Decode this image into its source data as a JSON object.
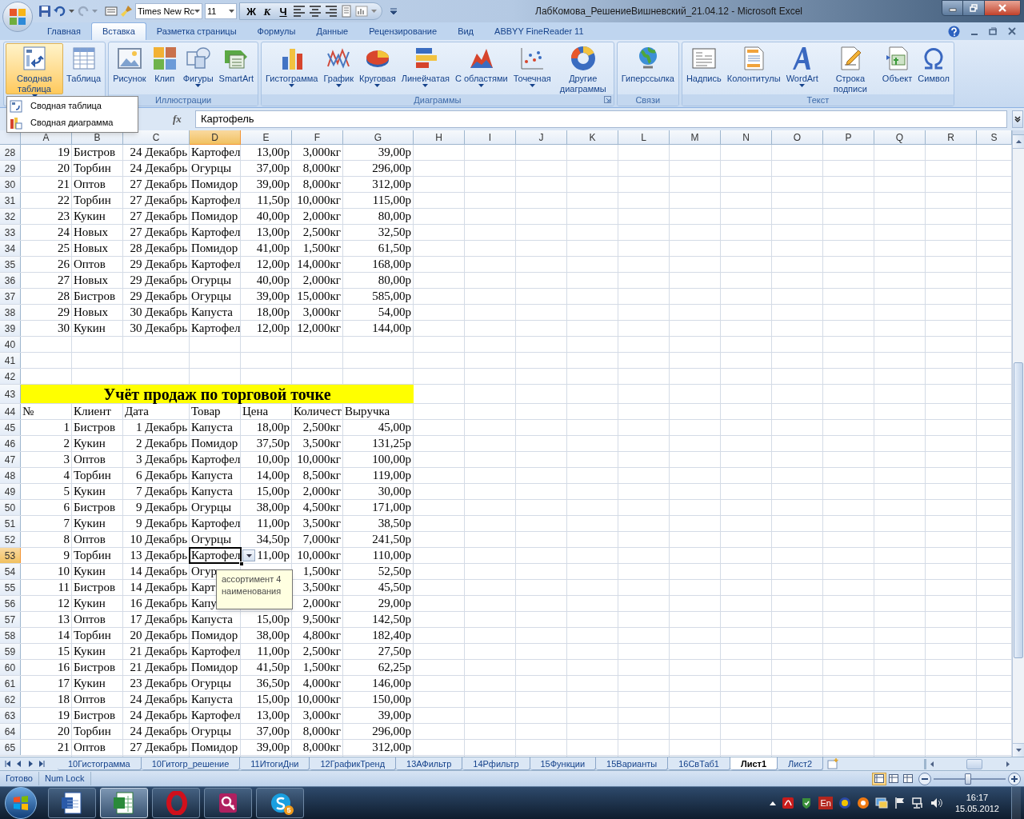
{
  "window": {
    "title": "ЛабКомова_РешениеВишневский_21.04.12 - Microsoft Excel"
  },
  "quick_access": {
    "font_box": "Times New Rc",
    "size_box": "11",
    "format_buttons": [
      "Ж",
      "К",
      "Ч"
    ]
  },
  "ribbon_tabs": [
    {
      "label": "Главная",
      "selected": false
    },
    {
      "label": "Вставка",
      "selected": true
    },
    {
      "label": "Разметка страницы",
      "selected": false
    },
    {
      "label": "Формулы",
      "selected": false
    },
    {
      "label": "Данные",
      "selected": false
    },
    {
      "label": "Рецензирование",
      "selected": false
    },
    {
      "label": "Вид",
      "selected": false
    },
    {
      "label": "ABBYY FineReader 11",
      "selected": false
    }
  ],
  "ribbon_groups": [
    {
      "buttons": [
        {
          "label": "Сводная таблица",
          "dropdown": true,
          "selected": true
        },
        {
          "label": "Таблица",
          "dropdown": false,
          "selected": false
        }
      ]
    },
    {
      "label": "Иллюстрации",
      "buttons": [
        {
          "label": "Рисунок",
          "dropdown": false,
          "selected": false
        },
        {
          "label": "Клип",
          "dropdown": false,
          "selected": false
        },
        {
          "label": "Фигуры",
          "dropdown": true,
          "selected": false
        },
        {
          "label": "SmartArt",
          "dropdown": false,
          "selected": false
        }
      ]
    },
    {
      "label": "Диаграммы",
      "launcher": true,
      "buttons": [
        {
          "label": "Гистограмма",
          "dropdown": true,
          "selected": false
        },
        {
          "label": "График",
          "dropdown": true,
          "selected": false
        },
        {
          "label": "Круговая",
          "dropdown": true,
          "selected": false
        },
        {
          "label": "Линейчатая",
          "dropdown": true,
          "selected": false
        },
        {
          "label": "С областями",
          "dropdown": true,
          "selected": false
        },
        {
          "label": "Точечная",
          "dropdown": true,
          "selected": false
        },
        {
          "label": "Другие диаграммы",
          "dropdown": true,
          "selected": false
        }
      ]
    },
    {
      "label": "Связи",
      "buttons": [
        {
          "label": "Гиперссылка",
          "dropdown": false,
          "selected": false
        }
      ]
    },
    {
      "label": "Текст",
      "buttons": [
        {
          "label": "Надпись",
          "dropdown": false,
          "selected": false
        },
        {
          "label": "Колонтитулы",
          "dropdown": false,
          "selected": false
        },
        {
          "label": "WordArt",
          "dropdown": true,
          "selected": false
        },
        {
          "label": "Строка подписи",
          "dropdown": true,
          "selected": false
        },
        {
          "label": "Объект",
          "dropdown": false,
          "selected": false
        },
        {
          "label": "Символ",
          "dropdown": false,
          "selected": false
        }
      ]
    }
  ],
  "dropdown_menu": {
    "items": [
      "Сводная таблица",
      "Сводная диаграмма"
    ]
  },
  "formula_bar": {
    "fx_label": "fx",
    "value": "Картофель"
  },
  "grid": {
    "cell_dropdown": true,
    "columns": [
      {
        "label": "A",
        "selected": false
      },
      {
        "label": "B",
        "selected": false
      },
      {
        "label": "C",
        "selected": false
      },
      {
        "label": "D",
        "selected": true
      },
      {
        "label": "E",
        "selected": false
      },
      {
        "label": "F",
        "selected": false
      },
      {
        "label": "G",
        "selected": false
      },
      {
        "label": "H",
        "selected": false
      },
      {
        "label": "I",
        "selected": false
      },
      {
        "label": "J",
        "selected": false
      },
      {
        "label": "K",
        "selected": false
      },
      {
        "label": "L",
        "selected": false
      },
      {
        "label": "M",
        "selected": false
      },
      {
        "label": "N",
        "selected": false
      },
      {
        "label": "O",
        "selected": false
      },
      {
        "label": "P",
        "selected": false
      },
      {
        "label": "Q",
        "selected": false
      },
      {
        "label": "R",
        "selected": false
      },
      {
        "label": "S",
        "selected": false
      }
    ],
    "rows": [
      {
        "header": "28",
        "selected": false,
        "kind": "data",
        "cells": [
          "19",
          "Бистров",
          "24 Декабрь",
          "Картофел",
          "13,00р",
          "3,000кг",
          "39,00р"
        ]
      },
      {
        "header": "29",
        "selected": false,
        "kind": "data",
        "cells": [
          "20",
          "Торбин",
          "24 Декабрь",
          "Огурцы",
          "37,00р",
          "8,000кг",
          "296,00р"
        ]
      },
      {
        "header": "30",
        "selected": false,
        "kind": "data",
        "cells": [
          "21",
          "Оптов",
          "27 Декабрь",
          "Помидор",
          "39,00р",
          "8,000кг",
          "312,00р"
        ]
      },
      {
        "header": "31",
        "selected": false,
        "kind": "data",
        "cells": [
          "22",
          "Торбин",
          "27 Декабрь",
          "Картофел",
          "11,50р",
          "10,000кг",
          "115,00р"
        ]
      },
      {
        "header": "32",
        "selected": false,
        "kind": "data",
        "cells": [
          "23",
          "Кукин",
          "27 Декабрь",
          "Помидор",
          "40,00р",
          "2,000кг",
          "80,00р"
        ]
      },
      {
        "header": "33",
        "selected": false,
        "kind": "data",
        "cells": [
          "24",
          "Новых",
          "27 Декабрь",
          "Картофел",
          "13,00р",
          "2,500кг",
          "32,50р"
        ]
      },
      {
        "header": "34",
        "selected": false,
        "kind": "data",
        "cells": [
          "25",
          "Новых",
          "28 Декабрь",
          "Помидор",
          "41,00р",
          "1,500кг",
          "61,50р"
        ]
      },
      {
        "header": "35",
        "selected": false,
        "kind": "data",
        "cells": [
          "26",
          "Оптов",
          "29 Декабрь",
          "Картофел",
          "12,00р",
          "14,000кг",
          "168,00р"
        ]
      },
      {
        "header": "36",
        "selected": false,
        "kind": "data",
        "cells": [
          "27",
          "Новых",
          "29 Декабрь",
          "Огурцы",
          "40,00р",
          "2,000кг",
          "80,00р"
        ]
      },
      {
        "header": "37",
        "selected": false,
        "kind": "data",
        "cells": [
          "28",
          "Бистров",
          "29 Декабрь",
          "Огурцы",
          "39,00р",
          "15,000кг",
          "585,00р"
        ]
      },
      {
        "header": "38",
        "selected": false,
        "kind": "data",
        "cells": [
          "29",
          "Новых",
          "30 Декабрь",
          "Капуста",
          "18,00р",
          "3,000кг",
          "54,00р"
        ]
      },
      {
        "header": "39",
        "selected": false,
        "kind": "data",
        "cells": [
          "30",
          "Кукин",
          "30 Декабрь",
          "Картофел",
          "12,00р",
          "12,000кг",
          "144,00р"
        ]
      },
      {
        "header": "40",
        "selected": false,
        "kind": "empty"
      },
      {
        "header": "41",
        "selected": false,
        "kind": "empty"
      },
      {
        "header": "42",
        "selected": false,
        "kind": "empty"
      },
      {
        "header": "43",
        "selected": false,
        "kind": "title",
        "text": "Учёт продаж по торговой точке"
      },
      {
        "header": "44",
        "selected": false,
        "kind": "header",
        "cells": [
          "№",
          "Клиент",
          "Дата",
          "Товар",
          "Цена",
          "Количест",
          "Выручка"
        ]
      },
      {
        "header": "45",
        "selected": false,
        "kind": "data",
        "cells": [
          "1",
          "Бистров",
          "1 Декабрь",
          "Капуста",
          "18,00р",
          "2,500кг",
          "45,00р"
        ]
      },
      {
        "header": "46",
        "selected": false,
        "kind": "data",
        "cells": [
          "2",
          "Кукин",
          "2 Декабрь",
          "Помидор",
          "37,50р",
          "3,500кг",
          "131,25р"
        ]
      },
      {
        "header": "47",
        "selected": false,
        "kind": "data",
        "cells": [
          "3",
          "Оптов",
          "3 Декабрь",
          "Картофел",
          "10,00р",
          "10,000кг",
          "100,00р"
        ]
      },
      {
        "header": "48",
        "selected": false,
        "kind": "data",
        "cells": [
          "4",
          "Торбин",
          "6 Декабрь",
          "Капуста",
          "14,00р",
          "8,500кг",
          "119,00р"
        ]
      },
      {
        "header": "49",
        "selected": false,
        "kind": "data",
        "cells": [
          "5",
          "Кукин",
          "7 Декабрь",
          "Капуста",
          "15,00р",
          "2,000кг",
          "30,00р"
        ]
      },
      {
        "header": "50",
        "selected": false,
        "kind": "data",
        "cells": [
          "6",
          "Бистров",
          "9 Декабрь",
          "Огурцы",
          "38,00р",
          "4,500кг",
          "171,00р"
        ]
      },
      {
        "header": "51",
        "selected": false,
        "kind": "data",
        "cells": [
          "7",
          "Кукин",
          "9 Декабрь",
          "Картофел",
          "11,00р",
          "3,500кг",
          "38,50р"
        ]
      },
      {
        "header": "52",
        "selected": false,
        "kind": "data",
        "cells": [
          "8",
          "Оптов",
          "10 Декабрь",
          "Огурцы",
          "34,50р",
          "7,000кг",
          "241,50р"
        ]
      },
      {
        "header": "53",
        "selected": true,
        "kind": "data",
        "cells": [
          "9",
          "Торбин",
          "13 Декабрь",
          "Картофел",
          "11,00р",
          "10,000кг",
          "110,00р"
        ]
      },
      {
        "header": "54",
        "selected": false,
        "kind": "data",
        "cells": [
          "10",
          "Кукин",
          "14 Декабрь",
          "Огур",
          null,
          "1,500кг",
          "52,50р"
        ]
      },
      {
        "header": "55",
        "selected": false,
        "kind": "data",
        "cells": [
          "11",
          "Бистров",
          "14 Декабрь",
          "Карт",
          null,
          "3,500кг",
          "45,50р"
        ]
      },
      {
        "header": "56",
        "selected": false,
        "kind": "data",
        "cells": [
          "12",
          "Кукин",
          "16 Декабрь",
          "Капу",
          null,
          "2,000кг",
          "29,00р"
        ]
      },
      {
        "header": "57",
        "selected": false,
        "kind": "data",
        "cells": [
          "13",
          "Оптов",
          "17 Декабрь",
          "Капуста",
          "15,00р",
          "9,500кг",
          "142,50р"
        ]
      },
      {
        "header": "58",
        "selected": false,
        "kind": "data",
        "cells": [
          "14",
          "Торбин",
          "20 Декабрь",
          "Помидор",
          "38,00р",
          "4,800кг",
          "182,40р"
        ]
      },
      {
        "header": "59",
        "selected": false,
        "kind": "data",
        "cells": [
          "15",
          "Кукин",
          "21 Декабрь",
          "Картофел",
          "11,00р",
          "2,500кг",
          "27,50р"
        ]
      },
      {
        "header": "60",
        "selected": false,
        "kind": "data",
        "cells": [
          "16",
          "Бистров",
          "21 Декабрь",
          "Помидор",
          "41,50р",
          "1,500кг",
          "62,25р"
        ]
      },
      {
        "header": "61",
        "selected": false,
        "kind": "data",
        "cells": [
          "17",
          "Кукин",
          "23 Декабрь",
          "Огурцы",
          "36,50р",
          "4,000кг",
          "146,00р"
        ]
      },
      {
        "header": "62",
        "selected": false,
        "kind": "data",
        "cells": [
          "18",
          "Оптов",
          "24 Декабрь",
          "Капуста",
          "15,00р",
          "10,000кг",
          "150,00р"
        ]
      },
      {
        "header": "63",
        "selected": false,
        "kind": "data",
        "cells": [
          "19",
          "Бистров",
          "24 Декабрь",
          "Картофел",
          "13,00р",
          "3,000кг",
          "39,00р"
        ]
      },
      {
        "header": "64",
        "selected": false,
        "kind": "data",
        "cells": [
          "20",
          "Торбин",
          "24 Декабрь",
          "Огурцы",
          "37,00р",
          "8,000кг",
          "296,00р"
        ]
      },
      {
        "header": "65",
        "selected": false,
        "kind": "data",
        "cells": [
          "21",
          "Оптов",
          "27 Декабрь",
          "Помидор",
          "39,00р",
          "8,000кг",
          "312,00р"
        ]
      }
    ]
  },
  "tooltip": {
    "text": "ассортимент 4 наименования"
  },
  "sheet_tabs": [
    {
      "label": "10Гистограмма",
      "selected": false
    },
    {
      "label": "10Гитогр_решение",
      "selected": false
    },
    {
      "label": "11ИтогиДни",
      "selected": false
    },
    {
      "label": "12ГрафикТренд",
      "selected": false
    },
    {
      "label": "13АФильтр",
      "selected": false
    },
    {
      "label": "14Рфильтр",
      "selected": false
    },
    {
      "label": "15Функции",
      "selected": false
    },
    {
      "label": "15Варианты",
      "selected": false
    },
    {
      "label": "16СвТаб1",
      "selected": false
    },
    {
      "label": "Лист1",
      "selected": true
    },
    {
      "label": "Лист2",
      "selected": false
    }
  ],
  "status_bar": {
    "items": [
      "Готово",
      "Num Lock"
    ],
    "zoom": {
      "level": 0.47
    }
  },
  "taskbar": {
    "apps": [
      {
        "selected": false
      },
      {
        "selected": true
      },
      {
        "selected": false
      },
      {
        "selected": false
      },
      {
        "selected": false,
        "badge": "5"
      }
    ],
    "language": "En",
    "time": "16:17",
    "date": "15.05.2012"
  }
}
